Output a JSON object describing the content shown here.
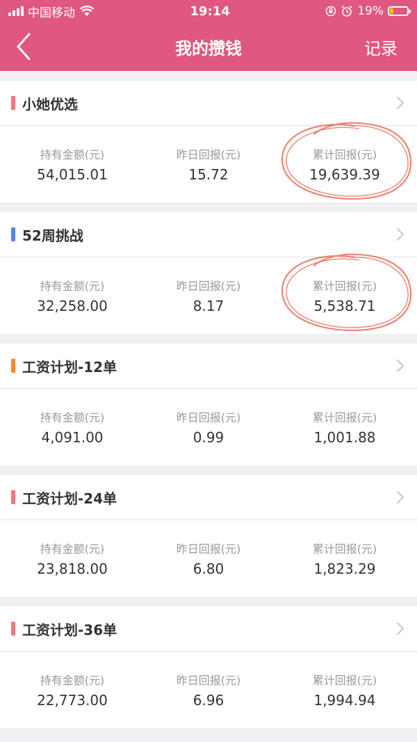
{
  "status": {
    "carrier": "中国移动",
    "time": "19:14",
    "battery": "19%"
  },
  "nav": {
    "title": "我的攒钱",
    "right": "记录"
  },
  "labels": {
    "held": "持有金额(元)",
    "yesterday": "昨日回报(元)",
    "total": "累计回报(元)"
  },
  "cards": [
    {
      "name": "小她优选",
      "color": "#f07880",
      "held": "54,015.01",
      "yesterday": "15.72",
      "total": "19,639.39",
      "circled": true
    },
    {
      "name": "52周挑战",
      "color": "#5a84e6",
      "held": "32,258.00",
      "yesterday": "8.17",
      "total": "5,538.71",
      "circled": true
    },
    {
      "name": "工资计划-12单",
      "color": "#f7882f",
      "held": "4,091.00",
      "yesterday": "0.99",
      "total": "1,001.88",
      "circled": false
    },
    {
      "name": "工资计划-24单",
      "color": "#f07880",
      "held": "23,818.00",
      "yesterday": "6.80",
      "total": "1,823.29",
      "circled": false
    },
    {
      "name": "工资计划-36单",
      "color": "#f07880",
      "held": "22,773.00",
      "yesterday": "6.96",
      "total": "1,994.94",
      "circled": false
    }
  ],
  "colors": {
    "header": "#e0577f",
    "annotation": "#e8705a"
  }
}
